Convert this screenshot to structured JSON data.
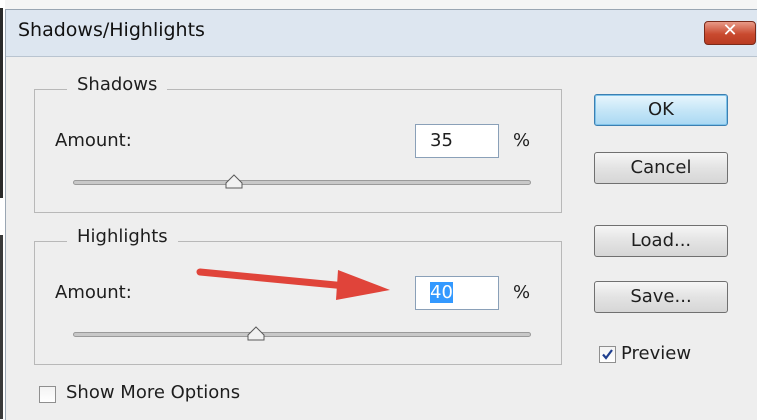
{
  "window": {
    "title": "Shadows/Highlights",
    "close_label": "✕"
  },
  "shadows": {
    "legend": "Shadows",
    "amount_label": "Amount:",
    "amount_value": "35",
    "unit": "%",
    "slider_fraction": 0.35
  },
  "highlights": {
    "legend": "Highlights",
    "amount_label": "Amount:",
    "amount_value": "40",
    "unit": "%",
    "slider_fraction": 0.4
  },
  "buttons": {
    "ok": "OK",
    "cancel": "Cancel",
    "load": "Load...",
    "save": "Save..."
  },
  "preview": {
    "label": "Preview",
    "checked": true
  },
  "more_options": {
    "label": "Show More Options",
    "checked": false
  },
  "annotation": {
    "arrow_color": "#e0443a"
  },
  "colors": {
    "selection": "#3399ff",
    "ok_border": "#3c7fb1"
  }
}
